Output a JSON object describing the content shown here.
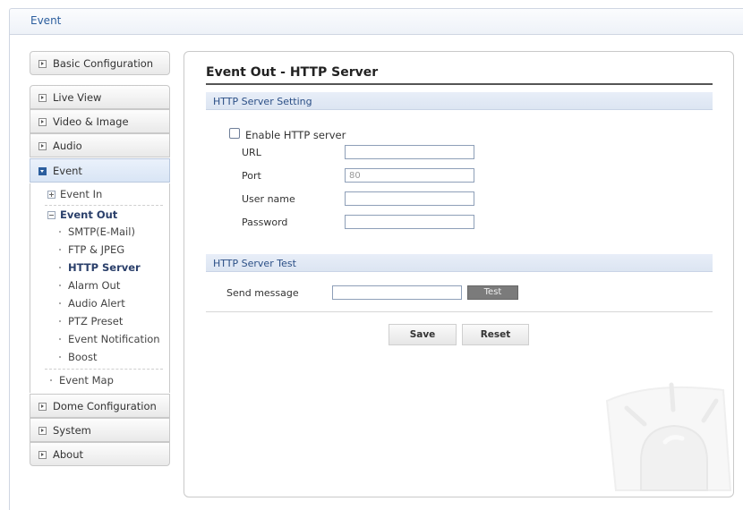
{
  "header": {
    "title": "Event"
  },
  "sidebar": {
    "basic_configuration": "Basic Configuration",
    "items": [
      {
        "label": "Live View"
      },
      {
        "label": "Video & Image"
      },
      {
        "label": "Audio"
      },
      {
        "label": "Event"
      }
    ],
    "event_sub": {
      "event_in": "Event In",
      "event_out": "Event Out",
      "event_out_children": [
        "SMTP(E-Mail)",
        "FTP & JPEG",
        "HTTP Server",
        "Alarm Out",
        "Audio Alert",
        "PTZ Preset",
        "Event Notification",
        "Boost"
      ],
      "event_map": "Event Map"
    },
    "bottom_items": [
      {
        "label": "Dome Configuration"
      },
      {
        "label": "System"
      },
      {
        "label": "About"
      }
    ]
  },
  "main": {
    "title": "Event Out - HTTP Server",
    "setting_section": "HTTP Server Setting",
    "enable_label": "Enable HTTP server",
    "enable_checked": false,
    "url_label": "URL",
    "url_value": "",
    "port_label": "Port",
    "port_value": "80",
    "user_label": "User name",
    "user_value": "",
    "password_label": "Password",
    "password_value": "",
    "test_section": "HTTP Server Test",
    "send_label": "Send message",
    "send_value": "",
    "test_button": "Test",
    "save_button": "Save",
    "reset_button": "Reset"
  },
  "colors": {
    "accent": "#2b5e9e",
    "section_bar": "#dce5f2",
    "active_nav": "#d9e5f5"
  }
}
